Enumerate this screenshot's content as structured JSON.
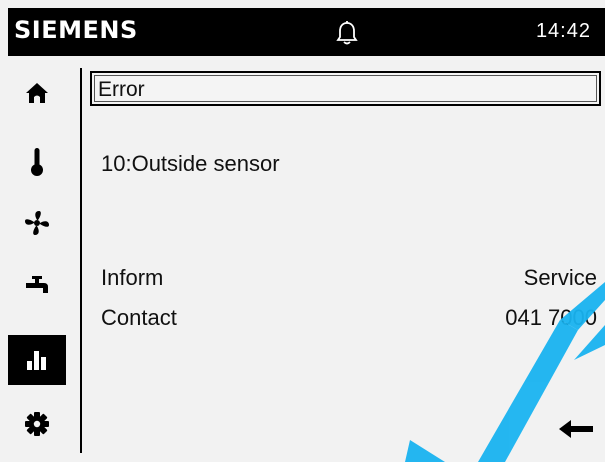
{
  "header": {
    "brand": "SIEMENS",
    "time": "14:42",
    "bell_icon": "bell-icon"
  },
  "sidebar": {
    "items": [
      {
        "name": "home",
        "icon": "home-icon",
        "active": false
      },
      {
        "name": "temperature",
        "icon": "thermometer-icon",
        "active": false
      },
      {
        "name": "ventilation",
        "icon": "fan-icon",
        "active": false
      },
      {
        "name": "hot-water",
        "icon": "faucet-icon",
        "active": false
      },
      {
        "name": "statistics",
        "icon": "bar-chart-icon",
        "active": true
      },
      {
        "name": "settings",
        "icon": "gear-icon",
        "active": false
      }
    ]
  },
  "main": {
    "title": "Error",
    "error_message": "10:Outside sensor",
    "info_rows": [
      {
        "label": "Inform",
        "value": "Service"
      },
      {
        "label": "Contact",
        "value": "041 7000"
      }
    ],
    "back_icon": "back-arrow-icon"
  },
  "colors": {
    "header_bg": "#000000",
    "screen_bg": "#f2f2f2",
    "active_nav_bg": "#000000",
    "watermark": "#19b3f0"
  }
}
